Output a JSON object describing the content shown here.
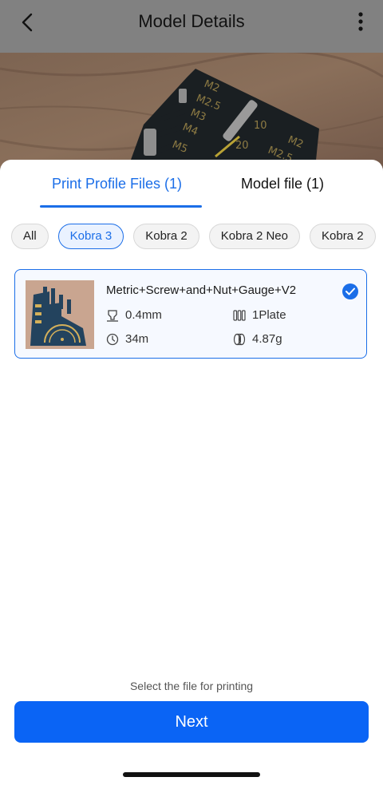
{
  "header": {
    "title": "Model Details"
  },
  "tabs": [
    {
      "label": "Print Profile Files  (1)",
      "active": true
    },
    {
      "label": "Model file  (1)",
      "active": false
    }
  ],
  "filters": [
    {
      "label": "All",
      "selected": false
    },
    {
      "label": "Kobra 3",
      "selected": true
    },
    {
      "label": "Kobra 2",
      "selected": false
    },
    {
      "label": "Kobra 2 Neo",
      "selected": false
    },
    {
      "label": "Kobra 2",
      "selected": false
    }
  ],
  "file": {
    "name": "Metric+Screw+and+Nut+Gauge+V2",
    "selected": true,
    "nozzle": "0.4mm",
    "plates": "1Plate",
    "time": "34m",
    "weight": "4.87g"
  },
  "footer": {
    "hint": "Select the file for printing",
    "next_label": "Next"
  },
  "colors": {
    "accent": "#1b6ee8",
    "button": "#0a64f5"
  },
  "icons": {
    "back": "chevron-left-icon",
    "more": "more-vertical-icon",
    "nozzle": "nozzle-icon",
    "plate": "plate-icon",
    "time": "clock-icon",
    "weight": "filament-spool-icon",
    "check": "checkmark-icon"
  }
}
